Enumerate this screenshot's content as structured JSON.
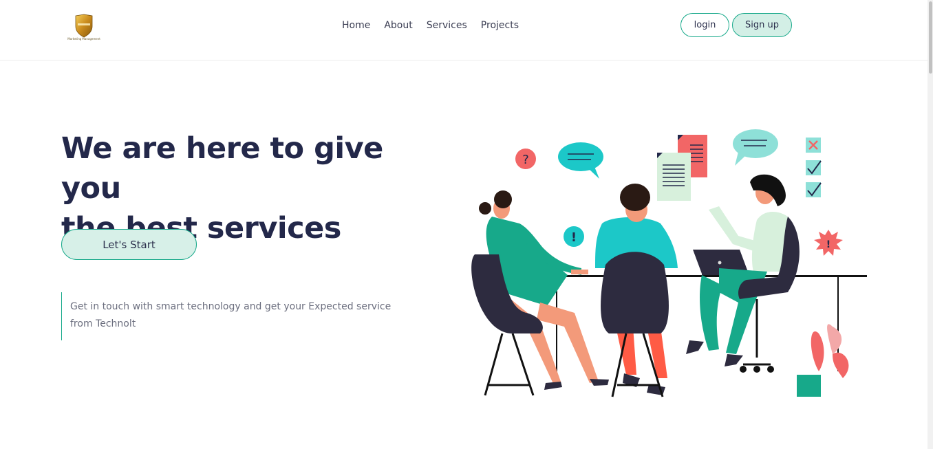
{
  "header": {
    "logo": {
      "icon": "shield-logo-icon",
      "tagline": "Marketing Management"
    },
    "nav": [
      {
        "label": "Home"
      },
      {
        "label": "About"
      },
      {
        "label": "Services"
      },
      {
        "label": "Projects"
      }
    ],
    "login_label": "login",
    "signup_label": "Sign up"
  },
  "hero": {
    "title_line1": "We are here to give you",
    "title_line2": "the best services",
    "cta_label": "Let's Start",
    "description": "Get in touch with smart technology and get your Expected service from Technolt"
  },
  "illustration": {
    "question_mark": "?",
    "exclamation_mark": "!",
    "burst_mark": "!"
  },
  "colors": {
    "accent": "#17a98a",
    "accent_light": "#d3efe6",
    "heading": "#23284a",
    "coral": "#f26666",
    "teal": "#1cc8c8"
  }
}
